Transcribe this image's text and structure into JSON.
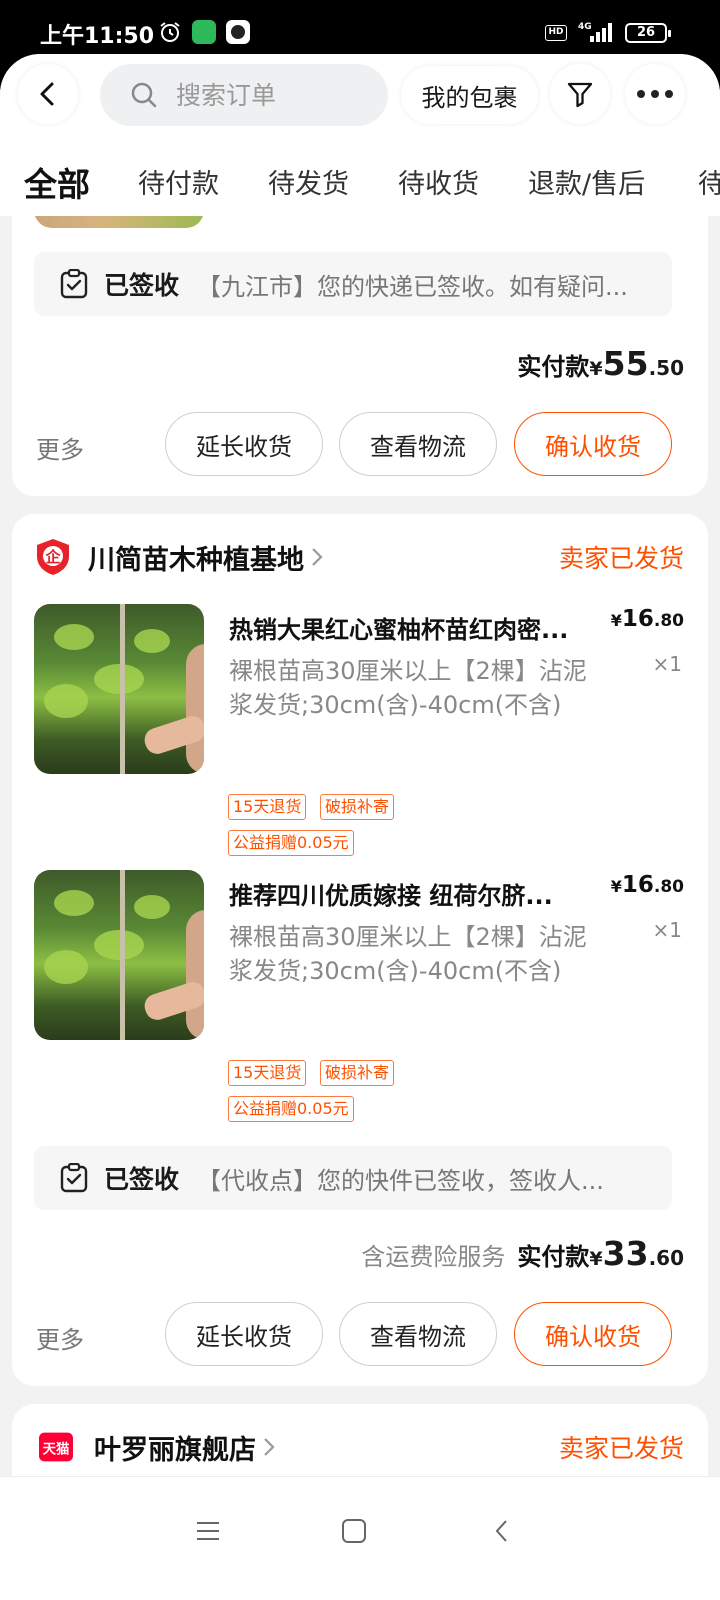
{
  "status_bar": {
    "time": "上午11:50",
    "hd_label": "HD",
    "network": "4G",
    "battery": "26"
  },
  "header": {
    "search_placeholder": "搜索订单",
    "packages_label": "我的包裹",
    "tabs": [
      "全部",
      "待付款",
      "待发货",
      "待收货",
      "退款/售后",
      "待"
    ]
  },
  "orders": [
    {
      "tracking": {
        "status": "已签收",
        "message": "【九江市】您的快递已签收。如有疑问..."
      },
      "payment": {
        "note": "",
        "label": "实付款",
        "currency": "¥",
        "integer": "55",
        "decimal": ".50"
      },
      "actions": {
        "more": "更多",
        "extend": "延长收货",
        "logistics": "查看物流",
        "confirm": "确认收货"
      }
    },
    {
      "shop": {
        "name": "川简苗木种植基地",
        "status": "卖家已发货",
        "badge": "企"
      },
      "items": [
        {
          "title": "热销大果红心蜜柚杯苗红肉密...",
          "sku": "裸根苗高30厘米以上【2棵】沾泥浆发货;30cm(含)-40cm(不含)",
          "price_currency": "¥",
          "price_int": "16",
          "price_dec": ".80",
          "qty": "×1",
          "tags": [
            "15天退货",
            "破损补寄",
            "公益捐赠0.05元"
          ]
        },
        {
          "title": "推荐四川优质嫁接 纽荷尔脐...",
          "sku": "裸根苗高30厘米以上【2棵】沾泥浆发货;30cm(含)-40cm(不含)",
          "price_currency": "¥",
          "price_int": "16",
          "price_dec": ".80",
          "qty": "×1",
          "tags": [
            "15天退货",
            "破损补寄",
            "公益捐赠0.05元"
          ]
        }
      ],
      "tracking": {
        "status": "已签收",
        "message": "【代收点】您的快件已签收，签收人..."
      },
      "payment": {
        "note": "含运费险服务",
        "label": "实付款",
        "currency": "¥",
        "integer": "33",
        "decimal": ".60"
      },
      "actions": {
        "more": "更多",
        "extend": "延长收货",
        "logistics": "查看物流",
        "confirm": "确认收货"
      }
    },
    {
      "shop": {
        "name": "叶罗丽旗舰店",
        "status": "卖家已发货",
        "badge": "天猫"
      }
    }
  ],
  "colors": {
    "accent": "#ff5000",
    "tmall": "#ff0036",
    "shield": "#e8222a"
  },
  "icons": [
    "back-icon",
    "search-icon",
    "filter-icon",
    "more-dots-icon",
    "signed-clipboard-icon",
    "enterprise-shield-icon",
    "chevron-right-icon",
    "menu-nav-icon",
    "home-nav-icon",
    "back-nav-icon"
  ]
}
